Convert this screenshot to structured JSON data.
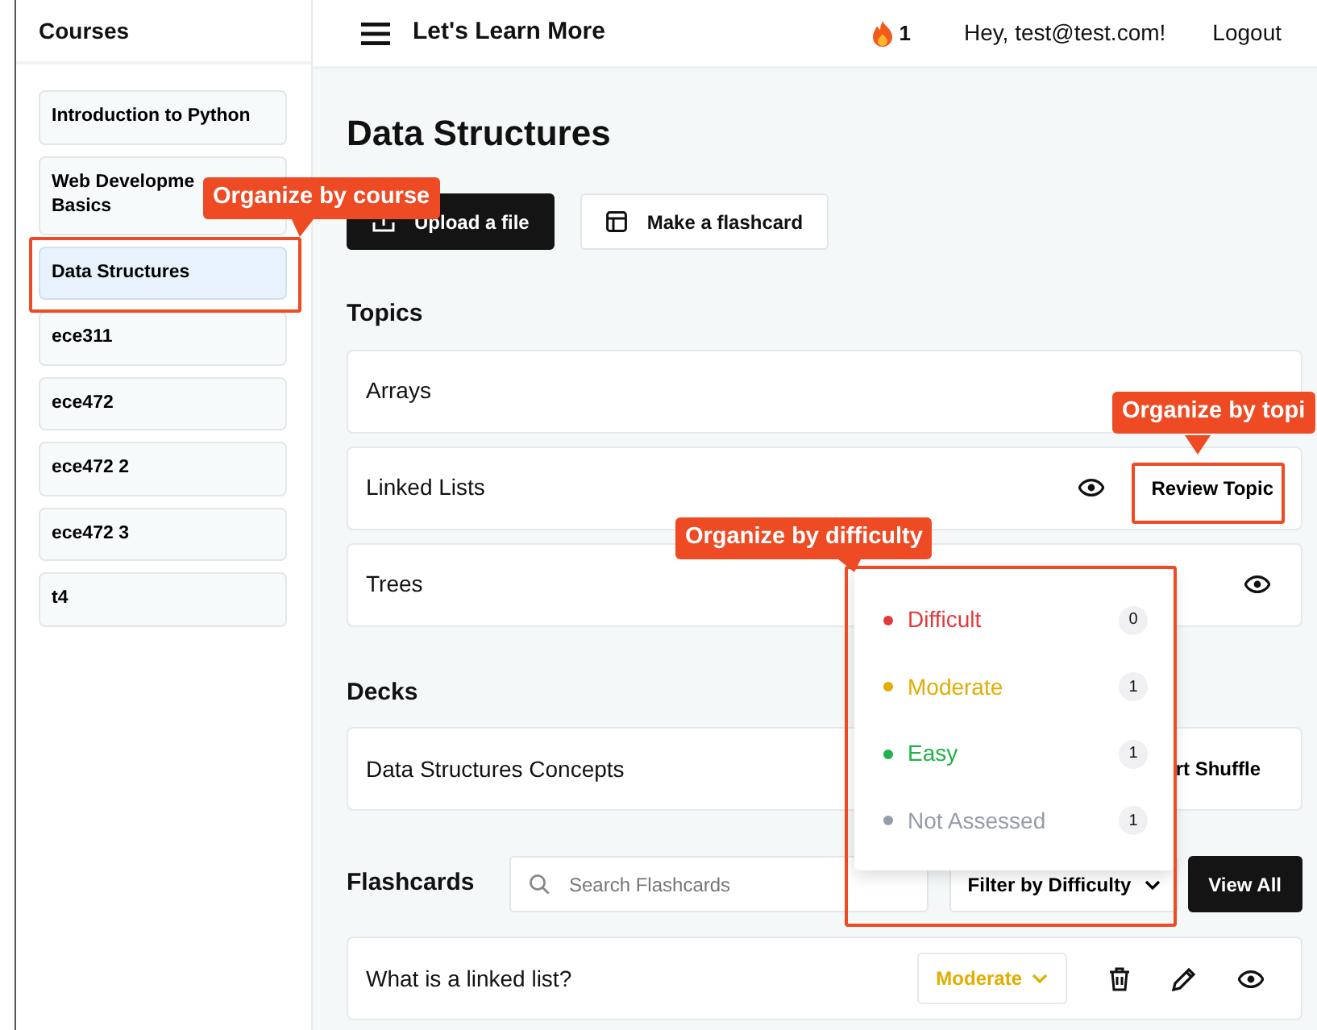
{
  "sidebar": {
    "title": "Courses",
    "courses": [
      {
        "label": "Introduction to Python",
        "selected": false
      },
      {
        "label": "Web Developme\nBasics",
        "selected": false
      },
      {
        "label": "Data Structures",
        "selected": true
      },
      {
        "label": "ece311",
        "selected": false
      },
      {
        "label": "ece472",
        "selected": false
      },
      {
        "label": "ece472 2",
        "selected": false
      },
      {
        "label": "ece472 3",
        "selected": false
      },
      {
        "label": "t4",
        "selected": false
      }
    ]
  },
  "topbar": {
    "title": "Let's Learn More",
    "streak": "1",
    "greeting": "Hey, test@test.com!",
    "logout": "Logout"
  },
  "page": {
    "title": "Data Structures",
    "actions": [
      {
        "kind": "upload",
        "label": "Upload a file"
      },
      {
        "kind": "flashcard",
        "label": "Make a flashcard"
      }
    ]
  },
  "topics": {
    "heading": "Topics",
    "items": [
      {
        "name": "Arrays",
        "viewable": false
      },
      {
        "name": "Linked Lists",
        "viewable": true,
        "review": "Review Topic"
      },
      {
        "name": "Trees",
        "viewable": true
      }
    ]
  },
  "decks": {
    "heading": "Decks",
    "items": [
      {
        "name": "Data Structures Concepts",
        "action": "rt Shuffle"
      }
    ]
  },
  "flashcards": {
    "heading": "Flashcards",
    "search": {
      "placeholder": "Search Flashcards"
    },
    "filter": "Filter by Difficulty",
    "view_all": "View All",
    "items": [
      {
        "question": "What is a linked list?",
        "difficulty": "Moderate",
        "color": "#e2ac00"
      }
    ]
  },
  "difficulty_menu": [
    {
      "label": "Difficult",
      "count": "0",
      "color": "#e5383b"
    },
    {
      "label": "Moderate",
      "count": "1",
      "color": "#e2ac00"
    },
    {
      "label": "Easy",
      "count": "1",
      "color": "#1fb24a"
    },
    {
      "label": "Not Assessed",
      "count": "1",
      "color": "#959cab"
    }
  ],
  "annotations": [
    {
      "text": "Organize by course"
    },
    {
      "text": "Organize by topi"
    },
    {
      "text": "Organize by difficulty"
    }
  ]
}
